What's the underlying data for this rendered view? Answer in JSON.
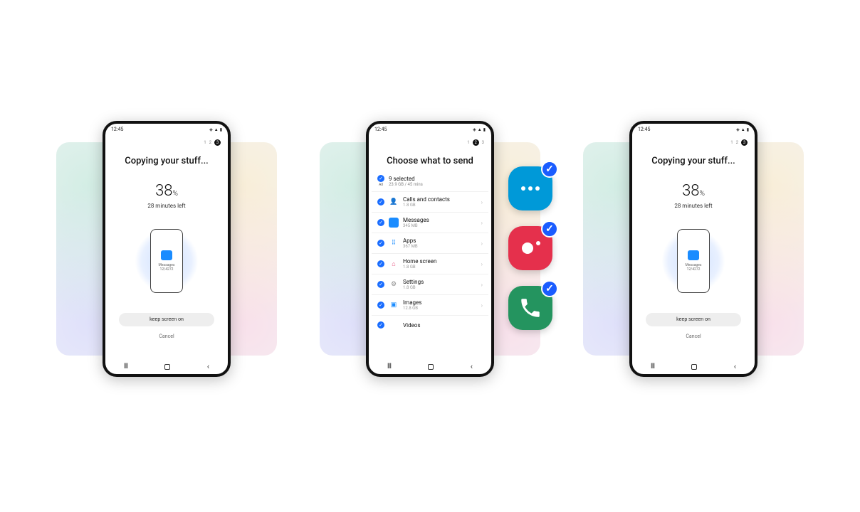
{
  "status": {
    "time": "12:45"
  },
  "copy_screen": {
    "steps_label_1": "1",
    "steps_label_2": "2",
    "steps_active": "3",
    "title": "Copying your stuff...",
    "percent": "38",
    "percent_unit": "%",
    "remaining": "28 minutes left",
    "current_app": "Messages",
    "current_app_sub": "12/4272",
    "keep_screen": "keep screen on",
    "cancel": "Cancel"
  },
  "choose_screen": {
    "steps_label_1": "1",
    "steps_active": "2",
    "steps_label_3": "3",
    "title": "Choose what to send",
    "all_label": "All",
    "summary_title": "9 selected",
    "summary_sub": "23.9 GB / 45 mins",
    "items": [
      {
        "label": "Calls and contacts",
        "sub": "1.8 GB"
      },
      {
        "label": "Messages",
        "sub": "345 MB"
      },
      {
        "label": "Apps",
        "sub": "367 MB"
      },
      {
        "label": "Home screen",
        "sub": "1.8 GB"
      },
      {
        "label": "Settings",
        "sub": "1.8 GB"
      },
      {
        "label": "Images",
        "sub": "12.8 GB"
      },
      {
        "label": "Videos",
        "sub": ""
      }
    ]
  },
  "nav": {
    "recent": "III",
    "back": "‹"
  }
}
